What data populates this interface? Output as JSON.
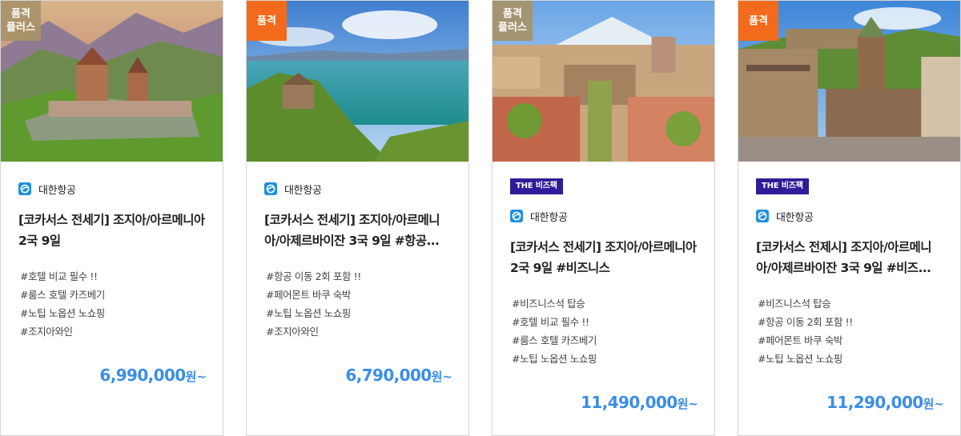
{
  "cards": [
    {
      "grade_label": "품격\n플러스",
      "grade_type": "plus",
      "airline": "대한항공",
      "title": "[코카서스 전세기] 조지아/아르메니아 2국 9일",
      "tags": [
        "#호텔 비교 필수 !!",
        "#룸스 호텔 카즈베기",
        "#노팁 노옵션 노쇼핑",
        "#조지아와인"
      ],
      "price": "6,990,000",
      "price_suffix": "원~"
    },
    {
      "grade_label": "품격",
      "grade_type": "basic",
      "airline": "대한항공",
      "title": "[코카서스 전세기] 조지아/아르메니아/아제르바이잔 3국 9일 #항공...",
      "tags": [
        "#항공 이동 2회 포함 !!",
        "#페어몬트 바쿠 숙박",
        "#노팁 노옵션 노쇼핑",
        "#조지아와인"
      ],
      "price": "6,790,000",
      "price_suffix": "원~"
    },
    {
      "grade_label": "품격\n플러스",
      "grade_type": "plus",
      "badge": "THE 비즈팩",
      "airline": "대한항공",
      "title": "[코카서스 전세기] 조지아/아르메니아 2국 9일 #비즈니스",
      "tags": [
        "#비즈니스석 탑승",
        "#호텔 비교 필수 !!",
        "#룸스 호텔 카즈베기",
        "#노팁 노옵션 노쇼핑"
      ],
      "price": "11,490,000",
      "price_suffix": "원~"
    },
    {
      "grade_label": "품격",
      "grade_type": "basic",
      "badge": "THE 비즈팩",
      "airline": "대한항공",
      "title": "[코카서스 전제시] 조지아/아르메니아/아제르바이잔 3국 9일 #비즈...",
      "tags": [
        "#비즈니스석 탑승",
        "#항공 이동 2회 포함 !!",
        "#페어몬트 바쿠 숙박",
        "#노팁 노옵션 노쇼핑"
      ],
      "price": "11,290,000",
      "price_suffix": "원~"
    }
  ],
  "colors": {
    "grade_plus": "#a89268",
    "grade_basic": "#f26a1b",
    "biz_badge": "#2f1c99",
    "price": "#3a8ee6",
    "airline_logo": "#1d8fe0"
  },
  "icons": [
    "korean-air-logo-icon"
  ]
}
